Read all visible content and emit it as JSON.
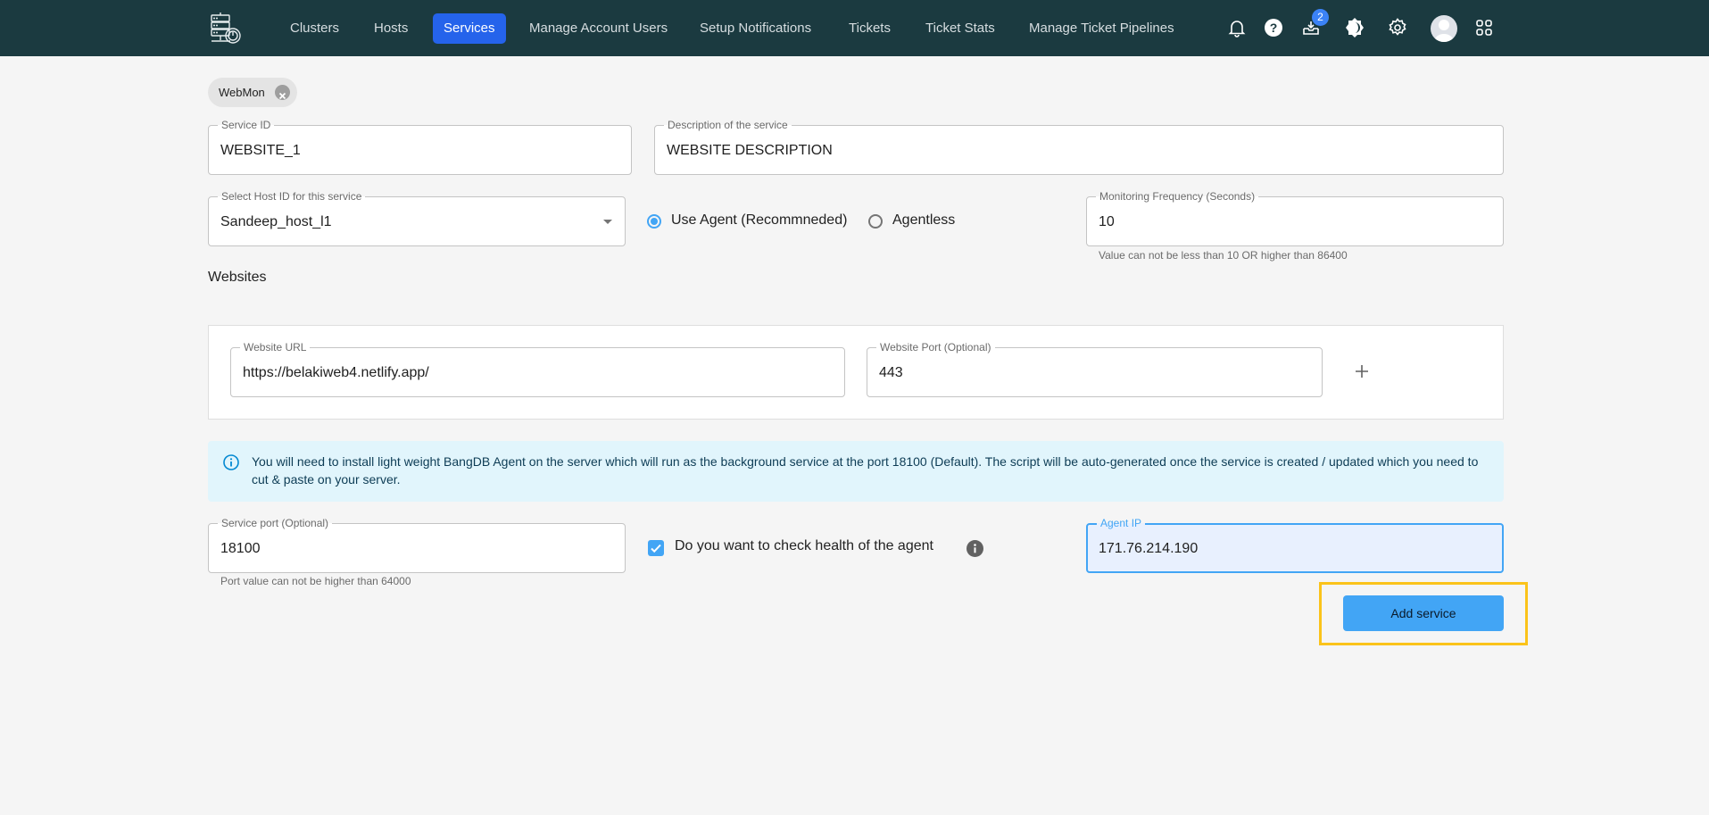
{
  "navbar": {
    "logo_icon": "server-monitor-logo",
    "items": [
      {
        "label": "Clusters",
        "active": false
      },
      {
        "label": "Hosts",
        "active": false
      },
      {
        "label": "Services",
        "active": true
      },
      {
        "label": "Manage Account Users",
        "active": false
      },
      {
        "label": "Setup Notifications",
        "active": false
      },
      {
        "label": "Tickets",
        "active": false
      },
      {
        "label": "Ticket Stats",
        "active": false
      },
      {
        "label": "Manage Ticket Pipelines",
        "active": false
      }
    ],
    "icons": [
      "bell-icon",
      "help-icon",
      "inbox-icon",
      "theme-toggle-icon",
      "gear-icon",
      "avatar",
      "apps-grid-icon"
    ],
    "inbox_badge": "2",
    "accent_color": "#2563eb",
    "background_color": "#1b3a40"
  },
  "chip": {
    "label": "WebMon"
  },
  "form": {
    "service_id": {
      "label": "Service ID",
      "value": "WEBSITE_1"
    },
    "description": {
      "label": "Description of the service",
      "value": "WEBSITE DESCRIPTION"
    },
    "host_select": {
      "label": "Select Host ID for this service",
      "value": "Sandeep_host_l1"
    },
    "mode": {
      "options": [
        {
          "label": "Use Agent (Recommneded)",
          "checked": true
        },
        {
          "label": "Agentless",
          "checked": false
        }
      ]
    },
    "frequency": {
      "label": "Monitoring Frequency (Seconds)",
      "value": "10",
      "helper": "Value can not be less than 10 OR higher than 86400"
    },
    "websites_title": "Websites",
    "websites": [
      {
        "url_label": "Website URL",
        "url_value": "https://belakiweb4.netlify.app/",
        "port_label": "Website Port (Optional)",
        "port_value": "443"
      }
    ],
    "info_text": "You will need to install light weight BangDB Agent on the server which will run as the background service at the port 18100 (Default). The script will be auto-generated once the service is created / updated which you need to cut & paste on your server.",
    "service_port": {
      "label": "Service port (Optional)",
      "value": "18100",
      "helper": "Port value can not be higher than 64000"
    },
    "health_check": {
      "label": "Do you want to check health of the agent",
      "checked": true
    },
    "agent_ip": {
      "label": "Agent IP",
      "value": "171.76.214.190"
    },
    "submit_label": "Add service",
    "primary_color": "#42a5f5",
    "highlight_color": "#fbc31a"
  }
}
